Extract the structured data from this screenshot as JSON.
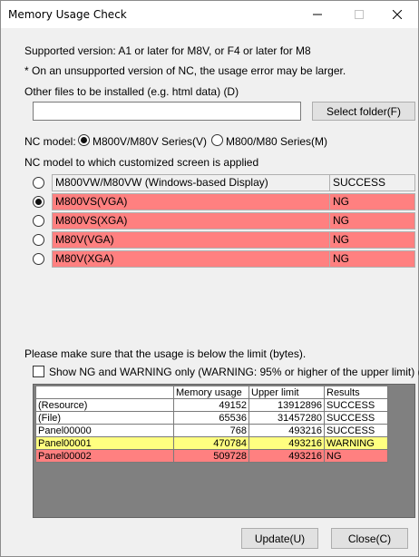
{
  "window": {
    "title": "Memory Usage Check"
  },
  "info": {
    "supported_version": "Supported version: A1 or later for M8V, or F4 or later for M8",
    "unsupported_note": "* On an unsupported version of NC, the usage error may be larger."
  },
  "other_files": {
    "label": "Other files to be installed (e.g. html data) (D)",
    "value": "",
    "select_folder_label": "Select folder(F)"
  },
  "nc_model": {
    "label": "NC model:",
    "options": [
      {
        "label": "M800V/M80V Series(V)",
        "selected": true
      },
      {
        "label": "M800/M80 Series(M)",
        "selected": false
      }
    ]
  },
  "applied": {
    "label": "NC model to which customized screen is applied",
    "rows": [
      {
        "name": "M800VW/M80VW (Windows-based Display)",
        "result": "SUCCESS",
        "selected": false
      },
      {
        "name": "M800VS(VGA)",
        "result": "NG",
        "selected": true
      },
      {
        "name": "M800VS(XGA)",
        "result": "NG",
        "selected": false
      },
      {
        "name": "M80V(VGA)",
        "result": "NG",
        "selected": false
      },
      {
        "name": "M80V(XGA)",
        "result": "NG",
        "selected": false
      }
    ]
  },
  "usage": {
    "note": "Please make sure that the usage is below the limit (bytes).",
    "filter_label": "Show NG and WARNING only (WARNING: 95% or higher of the upper limit) (N)",
    "filter_checked": false,
    "columns": [
      "",
      "Memory usage",
      "Upper limit",
      "Results"
    ],
    "rows": [
      {
        "name": "(Resource)",
        "usage": "49152",
        "limit": "13912896",
        "result": "SUCCESS"
      },
      {
        "name": "(File)",
        "usage": "65536",
        "limit": "31457280",
        "result": "SUCCESS"
      },
      {
        "name": "Panel00000",
        "usage": "768",
        "limit": "493216",
        "result": "SUCCESS"
      },
      {
        "name": "Panel00001",
        "usage": "470784",
        "limit": "493216",
        "result": "WARNING"
      },
      {
        "name": "Panel00002",
        "usage": "509728",
        "limit": "493216",
        "result": "NG"
      }
    ]
  },
  "buttons": {
    "update": "Update(U)",
    "close": "Close(C)"
  },
  "colors": {
    "ng": "#ff8080",
    "warning": "#ffff80",
    "grid_bg": "#808080"
  },
  "icons": [
    "minimize-icon",
    "maximize-icon",
    "close-icon"
  ]
}
